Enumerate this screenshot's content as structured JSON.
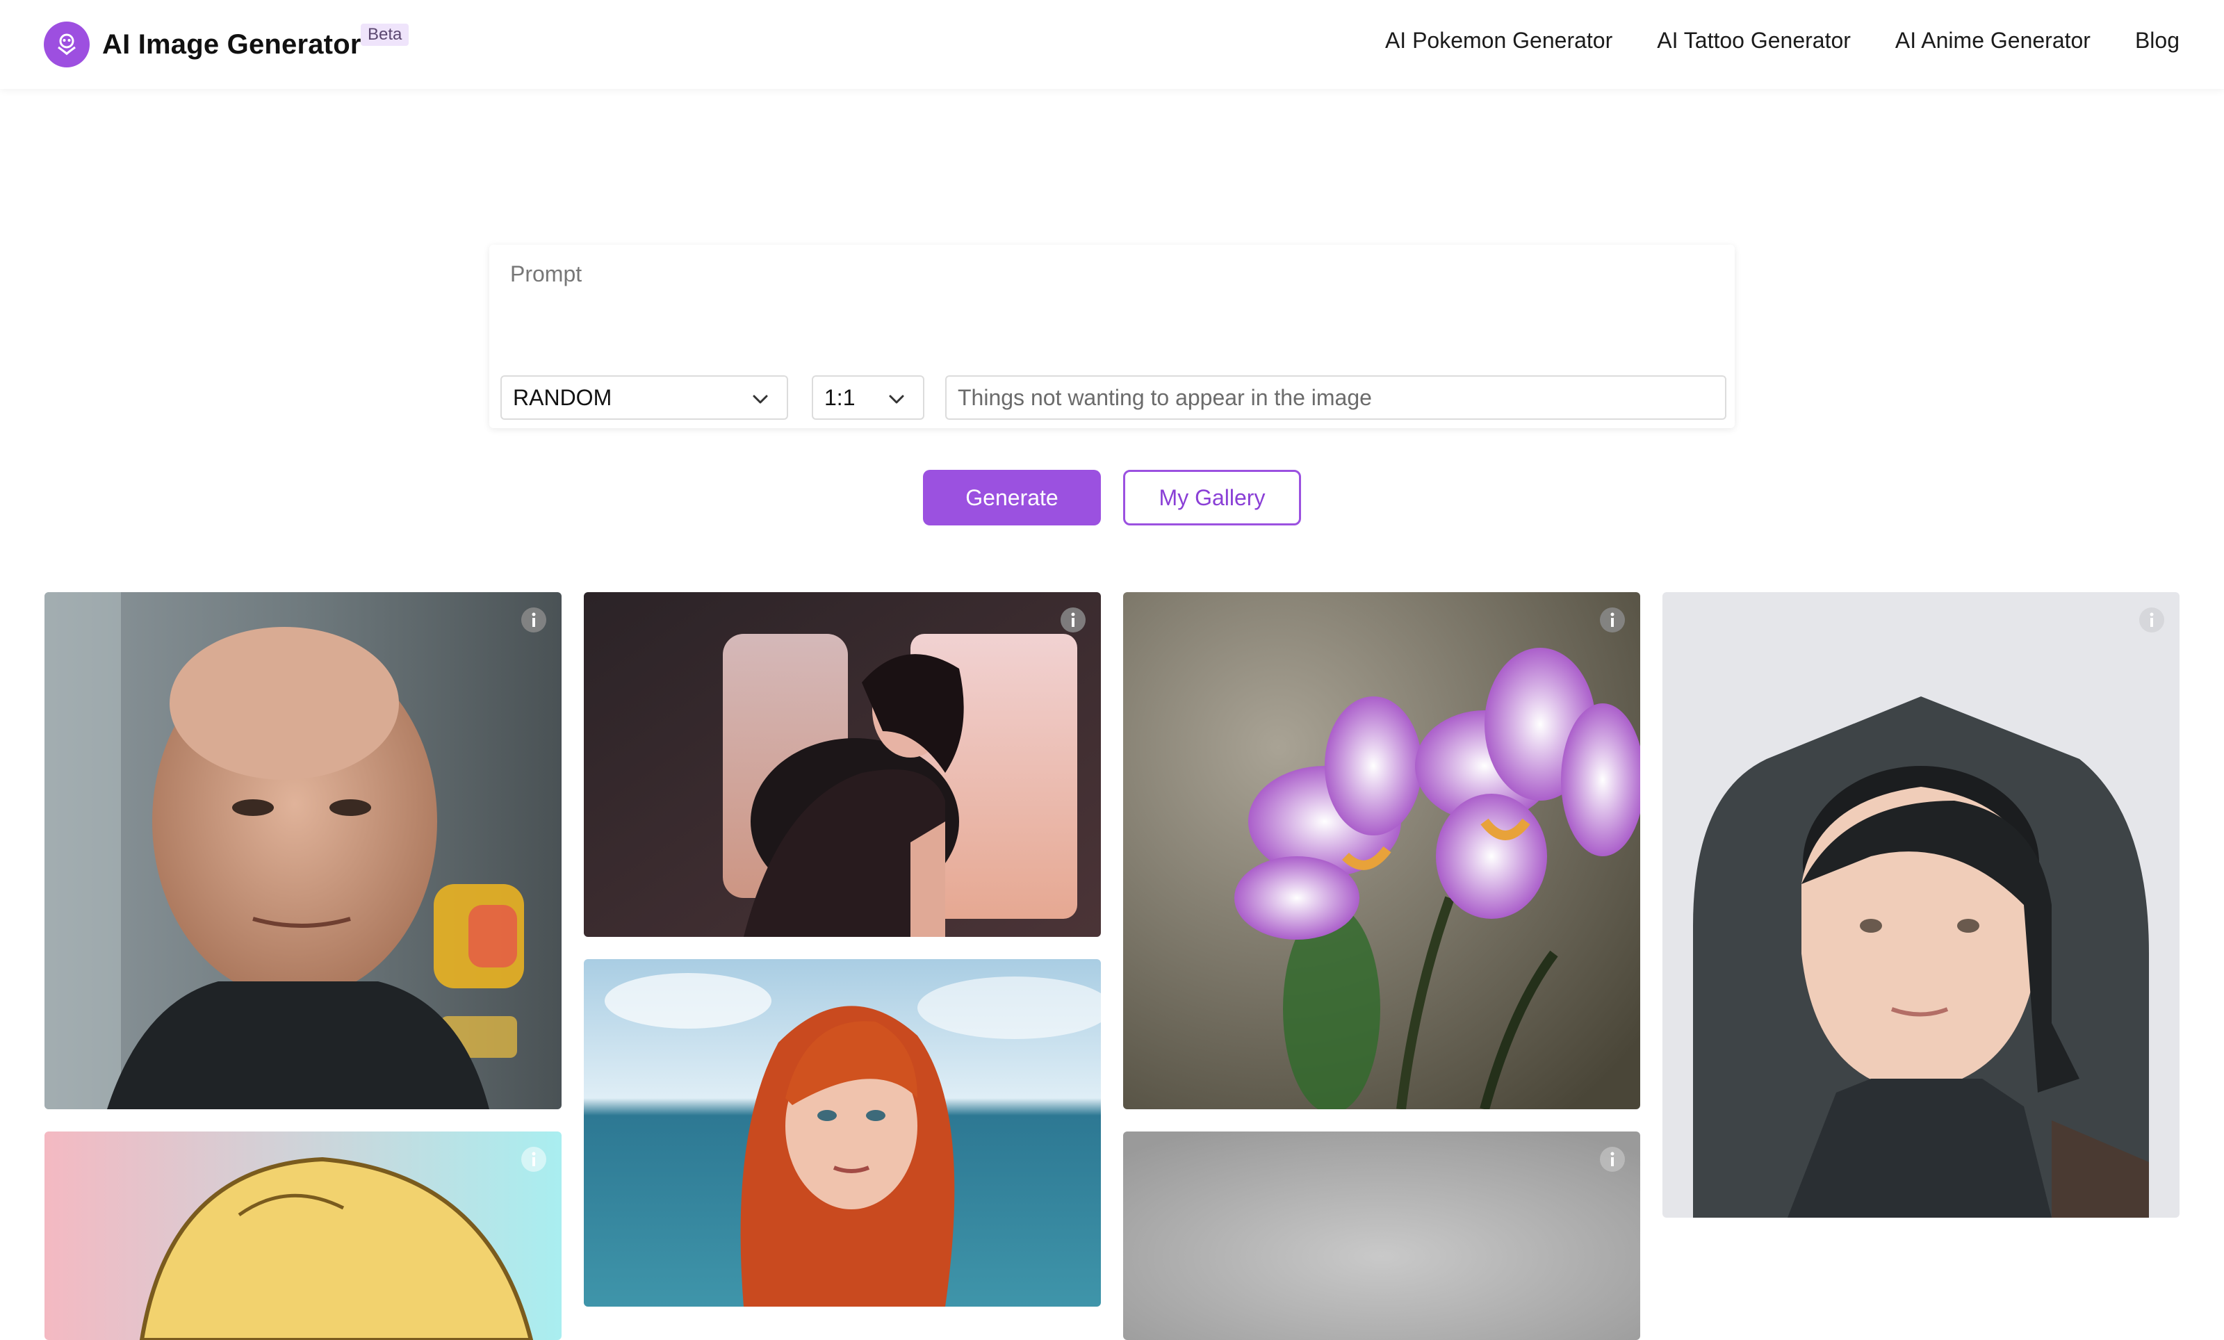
{
  "header": {
    "brand_title": "AI Image Generator",
    "beta_label": "Beta",
    "nav": [
      {
        "label": "AI Pokemon Generator"
      },
      {
        "label": "AI Tattoo Generator"
      },
      {
        "label": "AI Anime Generator"
      },
      {
        "label": "Blog"
      }
    ]
  },
  "form": {
    "prompt_placeholder": "Prompt",
    "style_value": "RANDOM",
    "ratio_value": "1:1",
    "negative_placeholder": "Things not wanting to appear in the image"
  },
  "actions": {
    "generate_label": "Generate",
    "gallery_label": "My Gallery"
  },
  "colors": {
    "accent": "#9b51e0",
    "accent_dark": "#8a3fd6",
    "beta_bg": "#efe4fb"
  },
  "gallery": {
    "items": [
      {
        "subject": "bald man portrait",
        "icon": "info-icon"
      },
      {
        "subject": "cyberpunk woman",
        "icon": "info-icon"
      },
      {
        "subject": "purple orchids",
        "icon": "info-icon"
      },
      {
        "subject": "illustrated woman portrait",
        "icon": "info-icon"
      },
      {
        "subject": "cartoon blonde character",
        "icon": "info-icon"
      },
      {
        "subject": "red-haired woman at beach",
        "icon": "info-icon"
      },
      {
        "subject": "grey image",
        "icon": "info-icon"
      }
    ]
  }
}
